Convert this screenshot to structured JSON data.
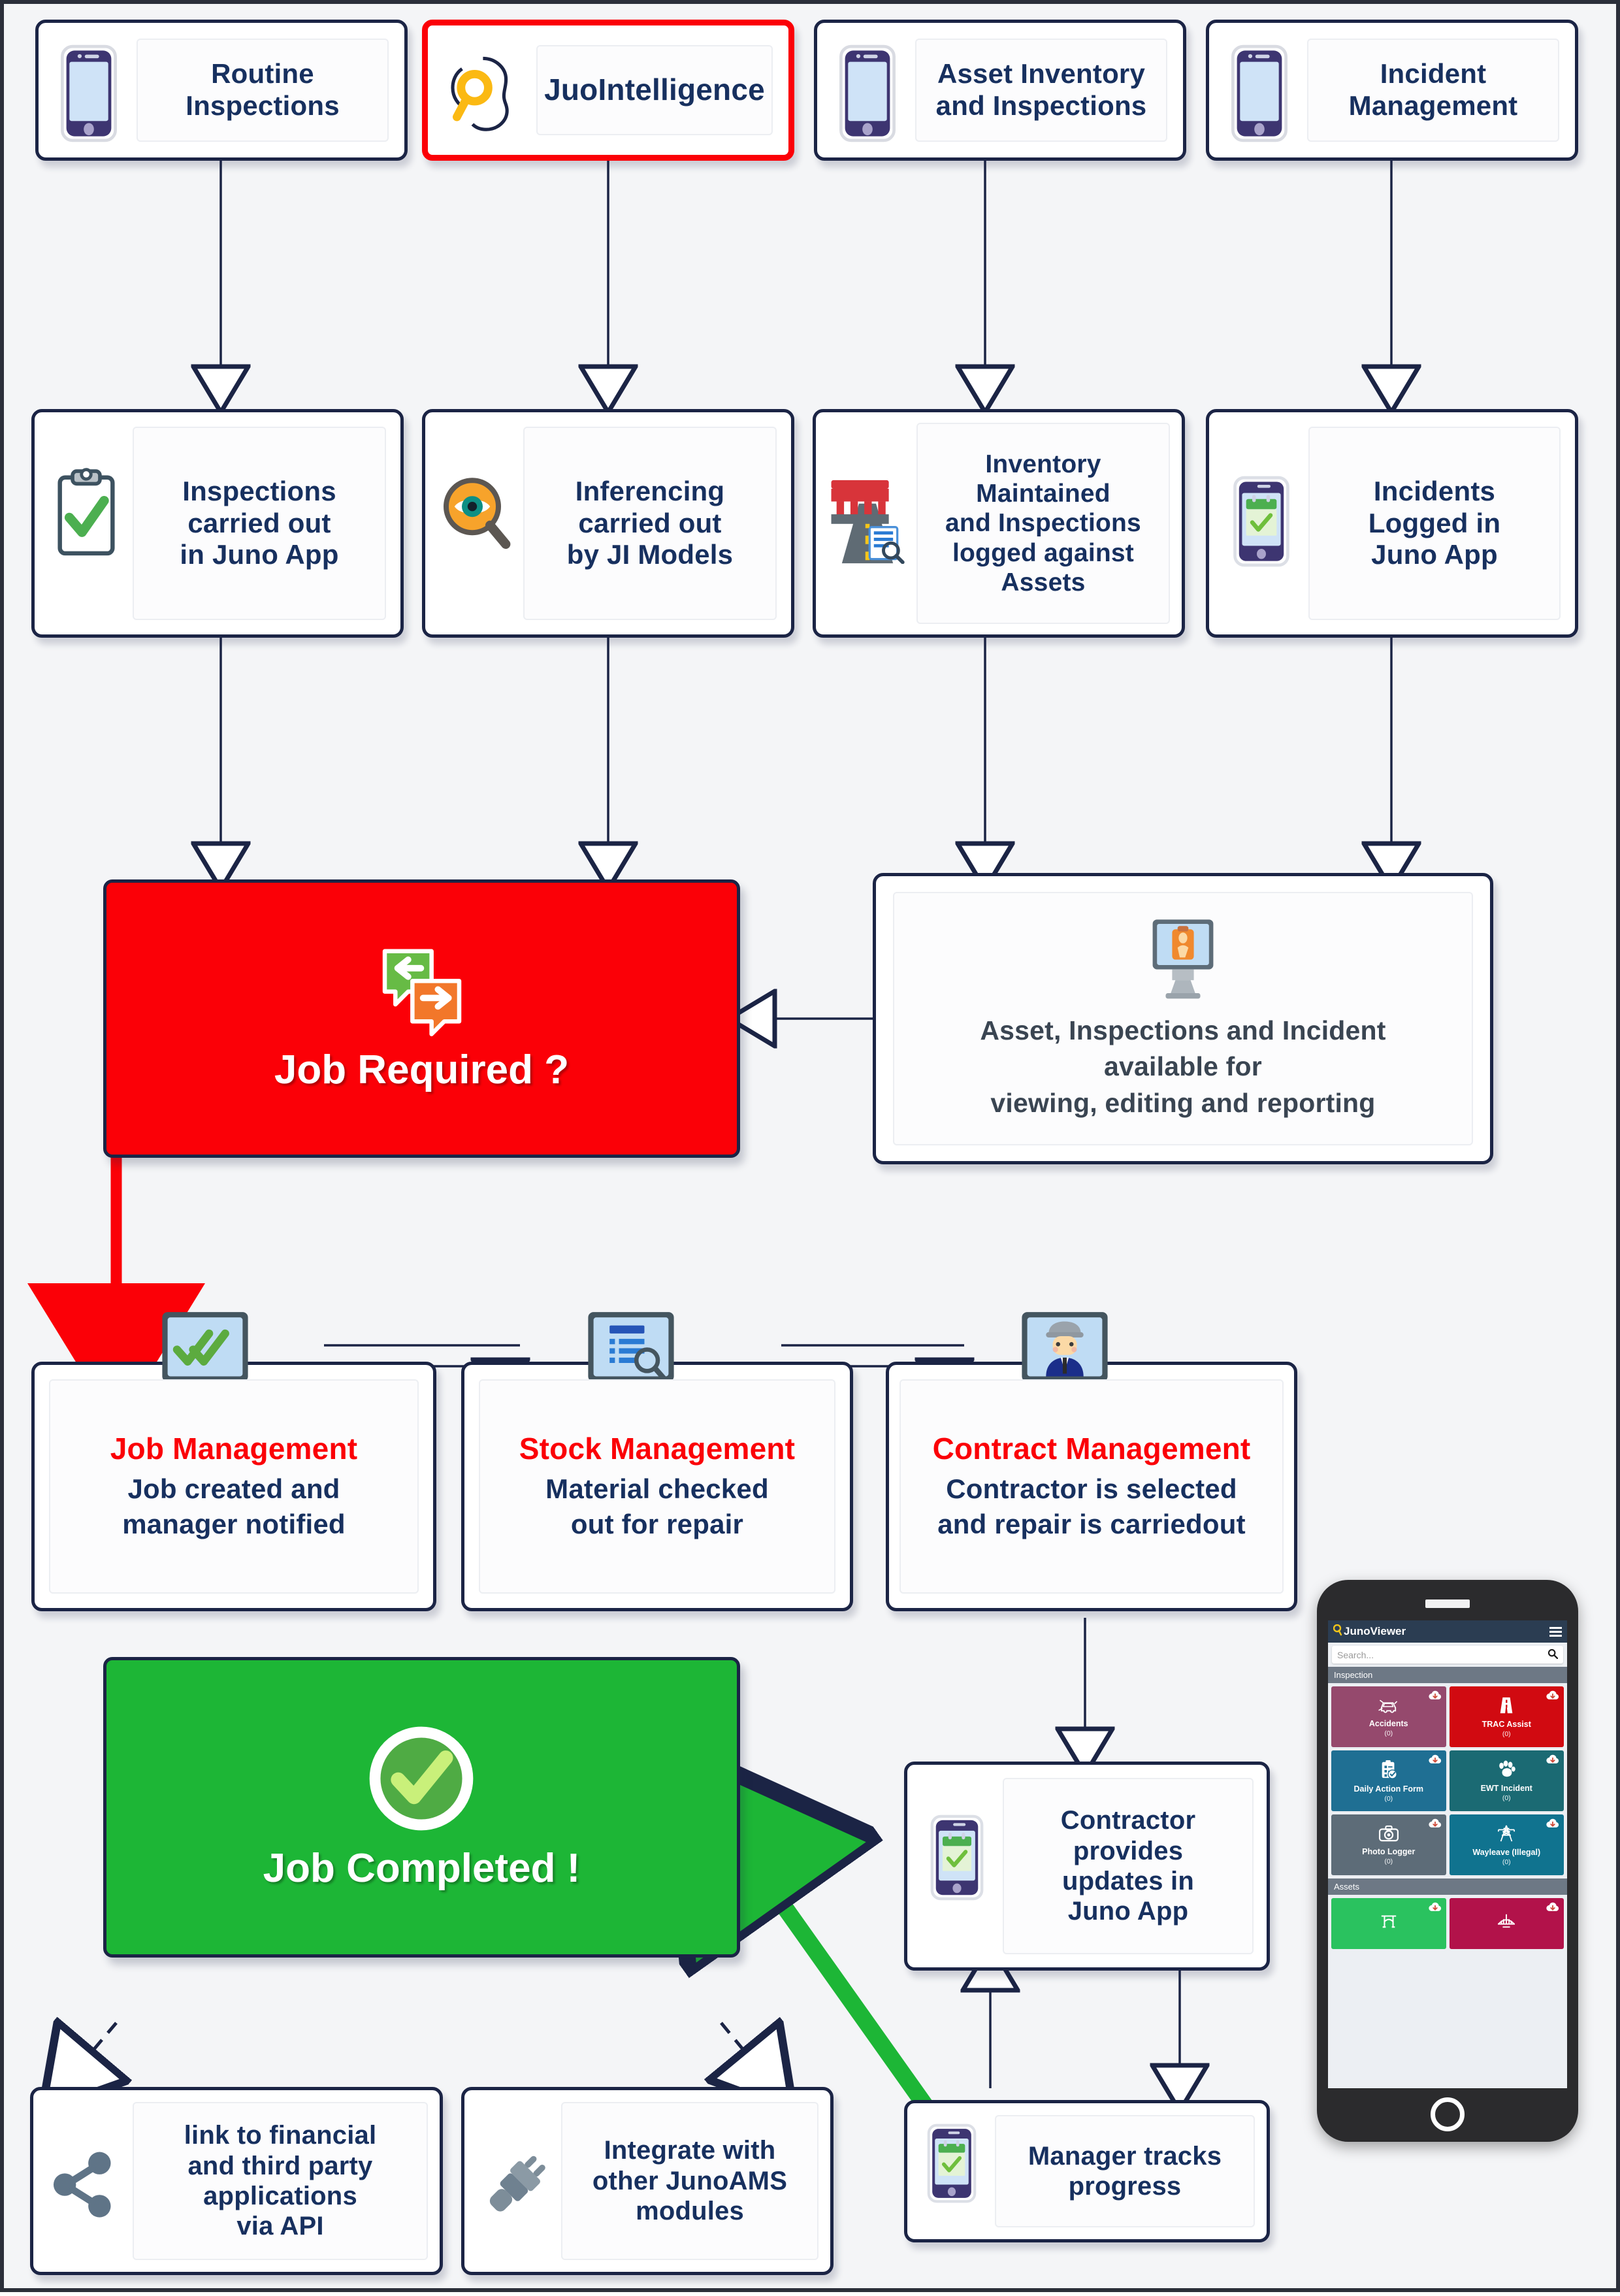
{
  "colors": {
    "page_bg": "#f4f5f7",
    "card_border": "#1b2445",
    "text_navy": "#17305f",
    "accent_red": "#fb0007",
    "accent_green": "#1db636",
    "phone_header": "#2b3d52"
  },
  "row1": [
    {
      "label": "Routine\nInspections",
      "icon": "mobile-phone-icon",
      "highlight": false
    },
    {
      "label": "JuoIntelligence",
      "icon": "ai-brain-magnifier-icon",
      "highlight": true
    },
    {
      "label": "Asset Inventory\nand Inspections",
      "icon": "mobile-phone-icon",
      "highlight": false
    },
    {
      "label": "Incident\nManagement",
      "icon": "mobile-phone-icon",
      "highlight": false
    }
  ],
  "row2": [
    {
      "label": "Inspections\ncarried out\nin Juno App",
      "icon": "clipboard-check-icon"
    },
    {
      "label": "Inferencing\ncarried out\nby JI Models",
      "icon": "eye-magnifier-icon"
    },
    {
      "label": "Inventory\nMaintained\nand Inspections\nlogged against\nAssets",
      "icon": "bridge-road-inspection-icon"
    },
    {
      "label": "Incidents\nLogged in\nJuno App",
      "icon": "mobile-calendar-check-icon"
    }
  ],
  "decision": {
    "label": "Job Required ?",
    "icon": "two-way-chat-arrows-icon"
  },
  "viewing_panel": {
    "label": "Asset, Inspections and Incident\navailable for\nviewing, editing and reporting",
    "icon": "desktop-clipboard-icon"
  },
  "row3": [
    {
      "title": "Job Management",
      "body": "Job created and\nmanager notified",
      "icon": "desktop-double-check-icon"
    },
    {
      "title": "Stock Management",
      "body": "Material checked\nout for repair",
      "icon": "desktop-document-search-icon"
    },
    {
      "title": "Contract Management",
      "body": "Contractor is selected\nand repair is carriedout",
      "icon": "desktop-engineer-icon"
    }
  ],
  "completed": {
    "label": "Job Completed !",
    "icon": "check-circle-icon"
  },
  "contractor": {
    "label": "Contractor\nprovides\nupdates in\nJuno App",
    "icon": "mobile-calendar-check-icon"
  },
  "manager": {
    "label": "Manager tracks\nprogress",
    "icon": "mobile-calendar-check-icon"
  },
  "outputs": [
    {
      "label": "link to financial\nand third party\napplications\nvia API",
      "icon": "share-nodes-icon"
    },
    {
      "label": "Integrate with\nother JunoAMS\nmodules",
      "icon": "plug-connector-icon"
    }
  ],
  "phone": {
    "brand": "JunoViewer",
    "menu_icon": "hamburger-menu-icon",
    "search_placeholder": "Search...",
    "search_icon": "search-icon",
    "sections": [
      {
        "title": "Inspection",
        "tiles": [
          {
            "label": "Accidents",
            "count": "(0)",
            "color": "#95496d",
            "glyph": "car-crash-icon",
            "download": "cloud-download-icon"
          },
          {
            "label": "TRAC Assist",
            "count": "(0)",
            "color": "#d10a11",
            "glyph": "road-icon",
            "download": "cloud-download-icon"
          },
          {
            "label": "Daily Action Form",
            "count": "(0)",
            "color": "#1f6f93",
            "glyph": "clipboard-check-icon",
            "download": "cloud-download-icon"
          },
          {
            "label": "EWT Incident",
            "count": "(0)",
            "color": "#1b6a73",
            "glyph": "paw-print-icon",
            "download": "cloud-download-icon"
          },
          {
            "label": "Photo Logger",
            "count": "(0)",
            "color": "#5d6c78",
            "glyph": "camera-icon",
            "download": "cloud-download-icon"
          },
          {
            "label": "Wayleave (Illegal)",
            "count": "(0)",
            "color": "#10738f",
            "glyph": "pylon-tower-icon",
            "download": "cloud-download-icon"
          }
        ]
      },
      {
        "title": "Assets",
        "tiles": [
          {
            "label": "",
            "count": "",
            "color": "#2ac25f",
            "glyph": "culvert-icon",
            "download": "cloud-download-icon"
          },
          {
            "label": "",
            "count": "",
            "color": "#b2124a",
            "glyph": "suspension-bridge-icon",
            "download": "cloud-download-icon"
          }
        ]
      }
    ]
  }
}
